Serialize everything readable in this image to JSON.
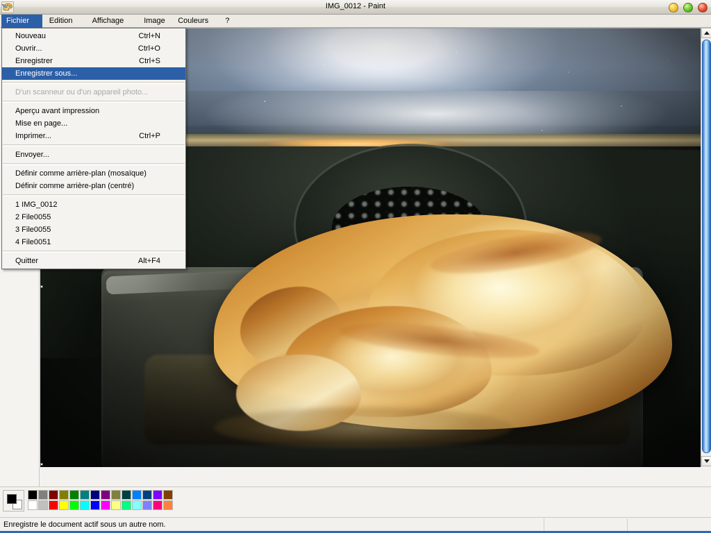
{
  "window": {
    "title": "IMG_0012 - Paint",
    "app_icon": "paint-palette-icon",
    "buttons": {
      "minimize_label": "",
      "maximize_label": "",
      "close_label": ""
    }
  },
  "menubar": {
    "items": [
      {
        "label": "Fichier",
        "open": true
      },
      {
        "label": "Edition",
        "open": false
      },
      {
        "label": "Affichage",
        "open": false
      },
      {
        "label": "Image",
        "open": false
      },
      {
        "label": "Couleurs",
        "open": false
      },
      {
        "label": "?",
        "open": false
      }
    ]
  },
  "file_menu": {
    "groups": [
      {
        "items": [
          {
            "label": "Nouveau",
            "accel": "Ctrl+N",
            "selected": false,
            "disabled": false
          },
          {
            "label": "Ouvrir...",
            "accel": "Ctrl+O",
            "selected": false,
            "disabled": false
          },
          {
            "label": "Enregistrer",
            "accel": "Ctrl+S",
            "selected": false,
            "disabled": false
          },
          {
            "label": "Enregistrer sous...",
            "accel": "",
            "selected": true,
            "disabled": false
          }
        ]
      },
      {
        "items": [
          {
            "label": "D'un scanneur ou d'un appareil photo...",
            "accel": "",
            "selected": false,
            "disabled": true
          }
        ]
      },
      {
        "items": [
          {
            "label": "Aperçu avant impression",
            "accel": "",
            "selected": false,
            "disabled": false
          },
          {
            "label": "Mise en page...",
            "accel": "",
            "selected": false,
            "disabled": false
          },
          {
            "label": "Imprimer...",
            "accel": "Ctrl+P",
            "selected": false,
            "disabled": false
          }
        ]
      },
      {
        "items": [
          {
            "label": "Envoyer...",
            "accel": "",
            "selected": false,
            "disabled": false
          }
        ]
      },
      {
        "items": [
          {
            "label": "Définir comme arrière-plan (mosaïque)",
            "accel": "",
            "selected": false,
            "disabled": false
          },
          {
            "label": "Définir comme arrière-plan (centré)",
            "accel": "",
            "selected": false,
            "disabled": false
          }
        ]
      },
      {
        "items": [
          {
            "label": "1 IMG_0012",
            "accel": "",
            "selected": false,
            "disabled": false
          },
          {
            "label": "2 File0055",
            "accel": "",
            "selected": false,
            "disabled": false
          },
          {
            "label": "3 File0055",
            "accel": "",
            "selected": false,
            "disabled": false
          },
          {
            "label": "4 File0051",
            "accel": "",
            "selected": false,
            "disabled": false
          }
        ]
      },
      {
        "items": [
          {
            "label": "Quitter",
            "accel": "Alt+F4",
            "selected": false,
            "disabled": false
          }
        ]
      }
    ]
  },
  "canvas": {
    "image_description": "Photograph of a whole roast chicken browning in a dark metal roasting pan inside an oven, with bright glare on the oven glass above and a circular fan grille on the back wall"
  },
  "scrollbars": {
    "vertical": {
      "up_arrow": "triangle-up-icon",
      "down_arrow": "triangle-down-icon"
    },
    "horizontal": {
      "left_arrow": "triangle-left-icon",
      "right_arrow": "triangle-right-icon"
    }
  },
  "palette": {
    "foreground": "#000000",
    "background": "#ffffff",
    "row1": [
      "#000000",
      "#808080",
      "#800000",
      "#808000",
      "#008000",
      "#008080",
      "#000080",
      "#800080",
      "#808040",
      "#004040",
      "#0080ff",
      "#004080",
      "#8000ff",
      "#804000"
    ],
    "row2": [
      "#ffffff",
      "#c0c0c0",
      "#ff0000",
      "#ffff00",
      "#00ff00",
      "#00ffff",
      "#0000ff",
      "#ff00ff",
      "#ffff80",
      "#00ff80",
      "#80ffff",
      "#8080ff",
      "#ff0080",
      "#ff8040"
    ]
  },
  "statusbar": {
    "message": "Enregistre le document actif sous un autre nom.",
    "panel2": "",
    "panel3": ""
  }
}
